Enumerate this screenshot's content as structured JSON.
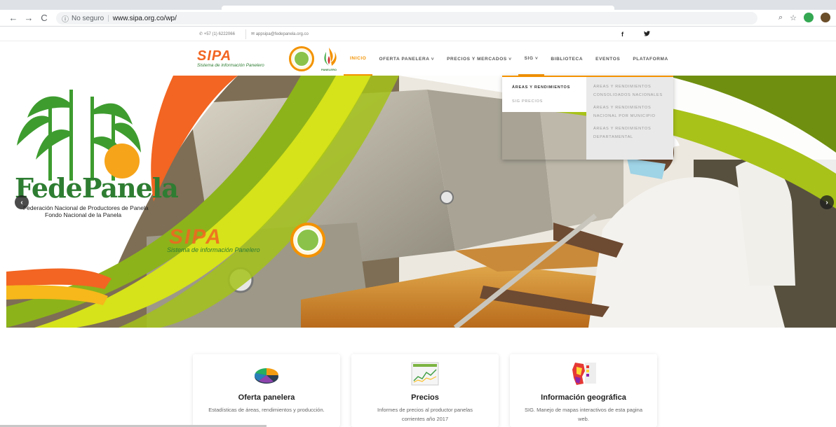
{
  "browser": {
    "nav": {
      "back": "←",
      "forward": "→",
      "reload": "C"
    },
    "security_label": "No seguro",
    "url": "www.sipa.org.co/wp/"
  },
  "topbar": {
    "phone": "+57 (1) 6222066",
    "email": "appsipa@fedepanela.org.co",
    "facebook": "f",
    "twitter": "♥"
  },
  "header": {
    "logo_word": "SIPA",
    "logo_sub": "Sistema de información Panelero",
    "brand_small": "FONDO NACIONAL PANELERO"
  },
  "menu": {
    "items": [
      {
        "label": "INICIO"
      },
      {
        "label": "OFERTA PANELERA ˅"
      },
      {
        "label": "PRECIOS Y MERCADOS ˅"
      },
      {
        "label": "SIG ˅"
      },
      {
        "label": "BIBLIOTECA"
      },
      {
        "label": "EVENTOS"
      },
      {
        "label": "PLATAFORMA"
      }
    ]
  },
  "dropdown": {
    "col1": [
      "ÁREAS Y RENDIMIENTOS",
      "SIG PRECIOS"
    ],
    "col2": [
      "ÁREAS Y RENDIMIENTOS CONSOLIDADOS NACIONALES",
      "ÁREAS Y RENDIMIENTOS NACIONAL POR MUNICIPIO",
      "ÁREAS Y RENDIMIENTOS DEPARTAMENTAL"
    ]
  },
  "hero": {
    "brand_title": "FedePanela",
    "brand_line1": "Federación Nacional de Productores de Panela",
    "brand_line2": "Fondo Nacional de la Panela",
    "sipa_word": "SIPA",
    "sipa_sub": "Sistema de información Panelero",
    "prev": "‹",
    "next": "›"
  },
  "cards": [
    {
      "title": "Oferta panelera",
      "desc": "Estadísticas de áreas, rendimientos y producción."
    },
    {
      "title": "Precios",
      "desc": "Informes  de precios al productor panelas corrientes  año 2017"
    },
    {
      "title": "Información geográfica",
      "desc": "SIG. Manejo de mapas interactivos de esta pagina web."
    }
  ],
  "colors": {
    "accent": "#f39200",
    "brand_orange": "#f26522",
    "brand_green": "#2e7d32"
  }
}
